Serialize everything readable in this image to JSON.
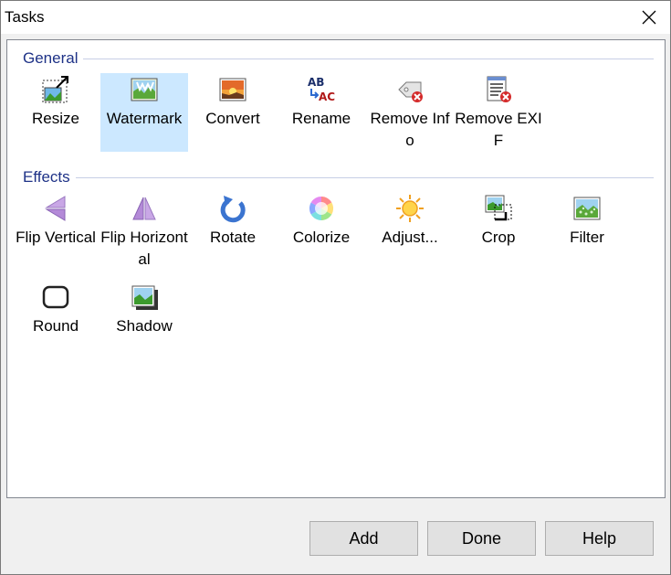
{
  "window": {
    "title": "Tasks"
  },
  "groups": {
    "general": {
      "label": "General",
      "items": [
        {
          "label": "Resize",
          "icon": "resize-icon"
        },
        {
          "label": "Watermark",
          "icon": "watermark-icon",
          "selected": true
        },
        {
          "label": "Convert",
          "icon": "convert-icon"
        },
        {
          "label": "Rename",
          "icon": "rename-icon"
        },
        {
          "label": "Remove Info",
          "icon": "remove-info-icon"
        },
        {
          "label": "Remove EXIF",
          "icon": "remove-exif-icon"
        }
      ]
    },
    "effects": {
      "label": "Effects",
      "items": [
        {
          "label": "Flip Vertical",
          "icon": "flip-vertical-icon"
        },
        {
          "label": "Flip Horizontal",
          "icon": "flip-horizontal-icon"
        },
        {
          "label": "Rotate",
          "icon": "rotate-icon"
        },
        {
          "label": "Colorize",
          "icon": "colorize-icon"
        },
        {
          "label": "Adjust...",
          "icon": "adjust-icon"
        },
        {
          "label": "Crop",
          "icon": "crop-icon"
        },
        {
          "label": "Filter",
          "icon": "filter-icon"
        },
        {
          "label": "Round",
          "icon": "round-icon"
        },
        {
          "label": "Shadow",
          "icon": "shadow-icon"
        }
      ]
    }
  },
  "buttons": {
    "add": "Add",
    "done": "Done",
    "help": "Help"
  },
  "colors": {
    "selection": "#cce8ff",
    "group_header": "#1e3287",
    "button_face": "#e1e1e1"
  }
}
